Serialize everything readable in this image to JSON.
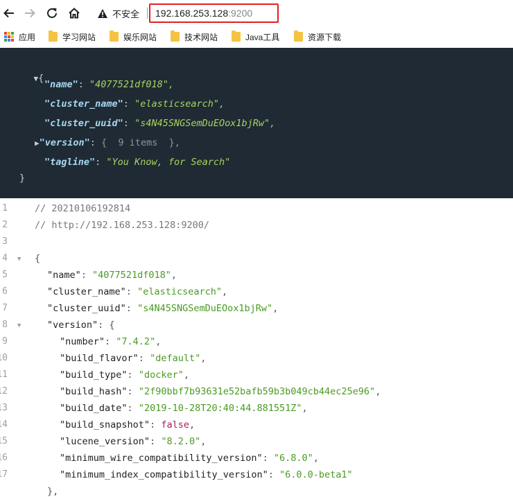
{
  "browser": {
    "security_label": "不安全",
    "url_host": "192.168.253.128",
    "url_port": ":9200"
  },
  "bookmarks": {
    "apps_label": "应用",
    "items": [
      "学习网站",
      "娱乐网站",
      "技术网站",
      "Java工具",
      "资源下载"
    ]
  },
  "viewer": {
    "open_brace": "{",
    "close_brace": "}",
    "rows": [
      {
        "key": "\"name\"",
        "value": "\"4077521df018\","
      },
      {
        "key": "\"cluster_name\"",
        "value": "\"elasticsearch\","
      },
      {
        "key": "\"cluster_uuid\"",
        "value": "\"s4N45SNGSemDuEOox1bjRw\","
      },
      {
        "key": "\"version\"",
        "value": "{  9 items  },"
      },
      {
        "key": "\"tagline\"",
        "value": "\"You Know, for Search\""
      }
    ]
  },
  "code": {
    "line_numbers": [
      "1",
      "2",
      "3",
      "4",
      "5",
      "6",
      "7",
      "8",
      "9",
      "10",
      "11",
      "12",
      "13",
      "14",
      "15",
      "16",
      "17",
      ""
    ],
    "comment_timestamp": "// 20210106192814",
    "comment_url": "// http://192.168.253.128:9200/",
    "open_brace": "{",
    "name_key": "\"name\"",
    "name_val": "\"4077521df018\"",
    "cluster_name_key": "\"cluster_name\"",
    "cluster_name_val": "\"elasticsearch\"",
    "cluster_uuid_key": "\"cluster_uuid\"",
    "cluster_uuid_val": "\"s4N45SNGSemDuEOox1bjRw\"",
    "version_key": "\"version\"",
    "number_key": "\"number\"",
    "number_val": "\"7.4.2\"",
    "build_flavor_key": "\"build_flavor\"",
    "build_flavor_val": "\"default\"",
    "build_type_key": "\"build_type\"",
    "build_type_val": "\"docker\"",
    "build_hash_key": "\"build_hash\"",
    "build_hash_val": "\"2f90bbf7b93631e52bafb59b3b049cb44ec25e96\"",
    "build_date_key": "\"build_date\"",
    "build_date_val": "\"2019-10-28T20:40:44.881551Z\"",
    "build_snapshot_key": "\"build_snapshot\"",
    "build_snapshot_val": "false",
    "lucene_version_key": "\"lucene_version\"",
    "lucene_version_val": "\"8.2.0\"",
    "min_wire_key": "\"minimum_wire_compatibility_version\"",
    "min_wire_val": "\"6.8.0\"",
    "min_index_key": "\"minimum_index_compatibility_version\"",
    "min_index_val": "\"6.0.0-beta1\"",
    "version_close": "},"
  },
  "colors": {
    "viewer_bg": "#1f2a34",
    "viewer_key": "#a7d9f0",
    "viewer_string": "#a8d460",
    "code_string": "#4a9a22",
    "code_boolean": "#a71d5d",
    "url_highlight": "#e02020"
  },
  "icons": {
    "back": "arrow-left-icon",
    "forward": "arrow-right-icon",
    "reload": "reload-icon",
    "home": "home-icon",
    "warning": "warning-triangle-icon",
    "apps": "apps-grid-icon",
    "folder": "folder-icon"
  }
}
